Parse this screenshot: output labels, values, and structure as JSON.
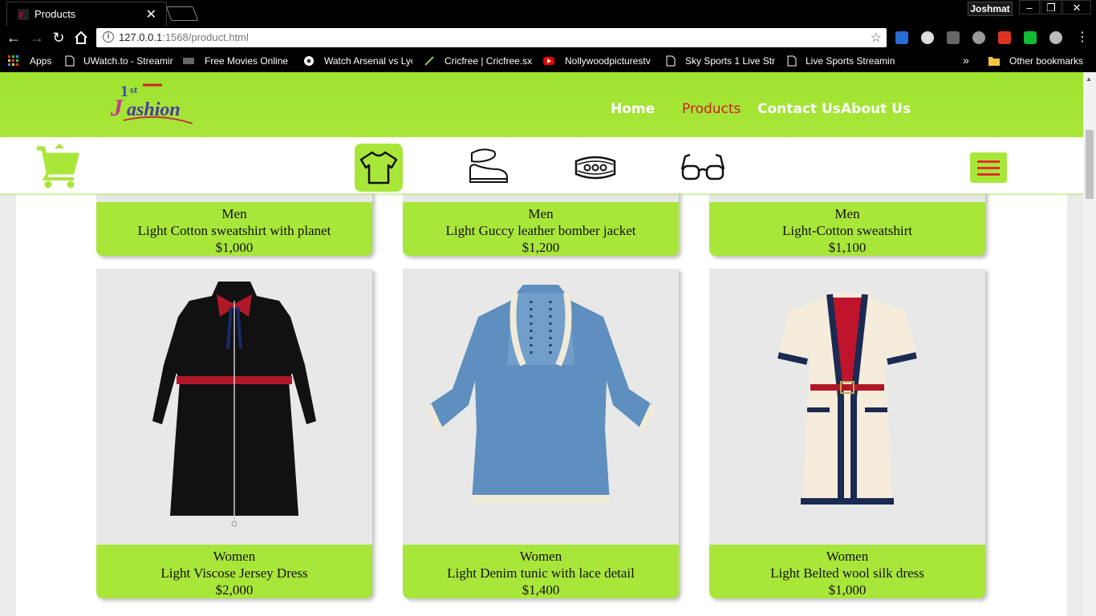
{
  "browser": {
    "tab_title": "Products",
    "profile_name": "Joshmat",
    "url_host": "127.0.0.1",
    "url_rest": ":1568/product.html",
    "bookmarks": [
      {
        "label": "Apps"
      },
      {
        "label": "UWatch.to - Streamin"
      },
      {
        "label": "Free Movies Online"
      },
      {
        "label": "Watch Arsenal vs Lyo"
      },
      {
        "label": "Cricfree | Cricfree.sx"
      },
      {
        "label": "Nollywoodpicturestv"
      },
      {
        "label": "Sky Sports 1 Live Str"
      },
      {
        "label": "Live Sports Streamin"
      }
    ],
    "other_bookmarks": "Other bookmarks",
    "overflow": "»"
  },
  "site": {
    "nav": [
      {
        "label": "Home"
      },
      {
        "label": "Products"
      },
      {
        "label": "Contact Us"
      },
      {
        "label": "About Us"
      }
    ],
    "categories": [
      "shirt-icon",
      "shoe-icon",
      "bracelet-icon",
      "glasses-icon"
    ],
    "colors": {
      "accent": "#a9e63a",
      "active": "#d0202a"
    }
  },
  "products_top": [
    {
      "category": "Men",
      "name": "Light Cotton sweatshirt with planet",
      "price": "$1,000"
    },
    {
      "category": "Men",
      "name": "Light Guccy leather bomber jacket",
      "price": "$1,200"
    },
    {
      "category": "Men",
      "name": "Light-Cotton sweatshirt",
      "price": "$1,100"
    }
  ],
  "products": [
    {
      "category": "Women",
      "name": "Light Viscose Jersey Dress",
      "price": "$2,000"
    },
    {
      "category": "Women",
      "name": "Light Denim tunic with lace detail",
      "price": "$1,400"
    },
    {
      "category": "Women",
      "name": "Light Belted wool silk dress",
      "price": "$1,000"
    }
  ]
}
